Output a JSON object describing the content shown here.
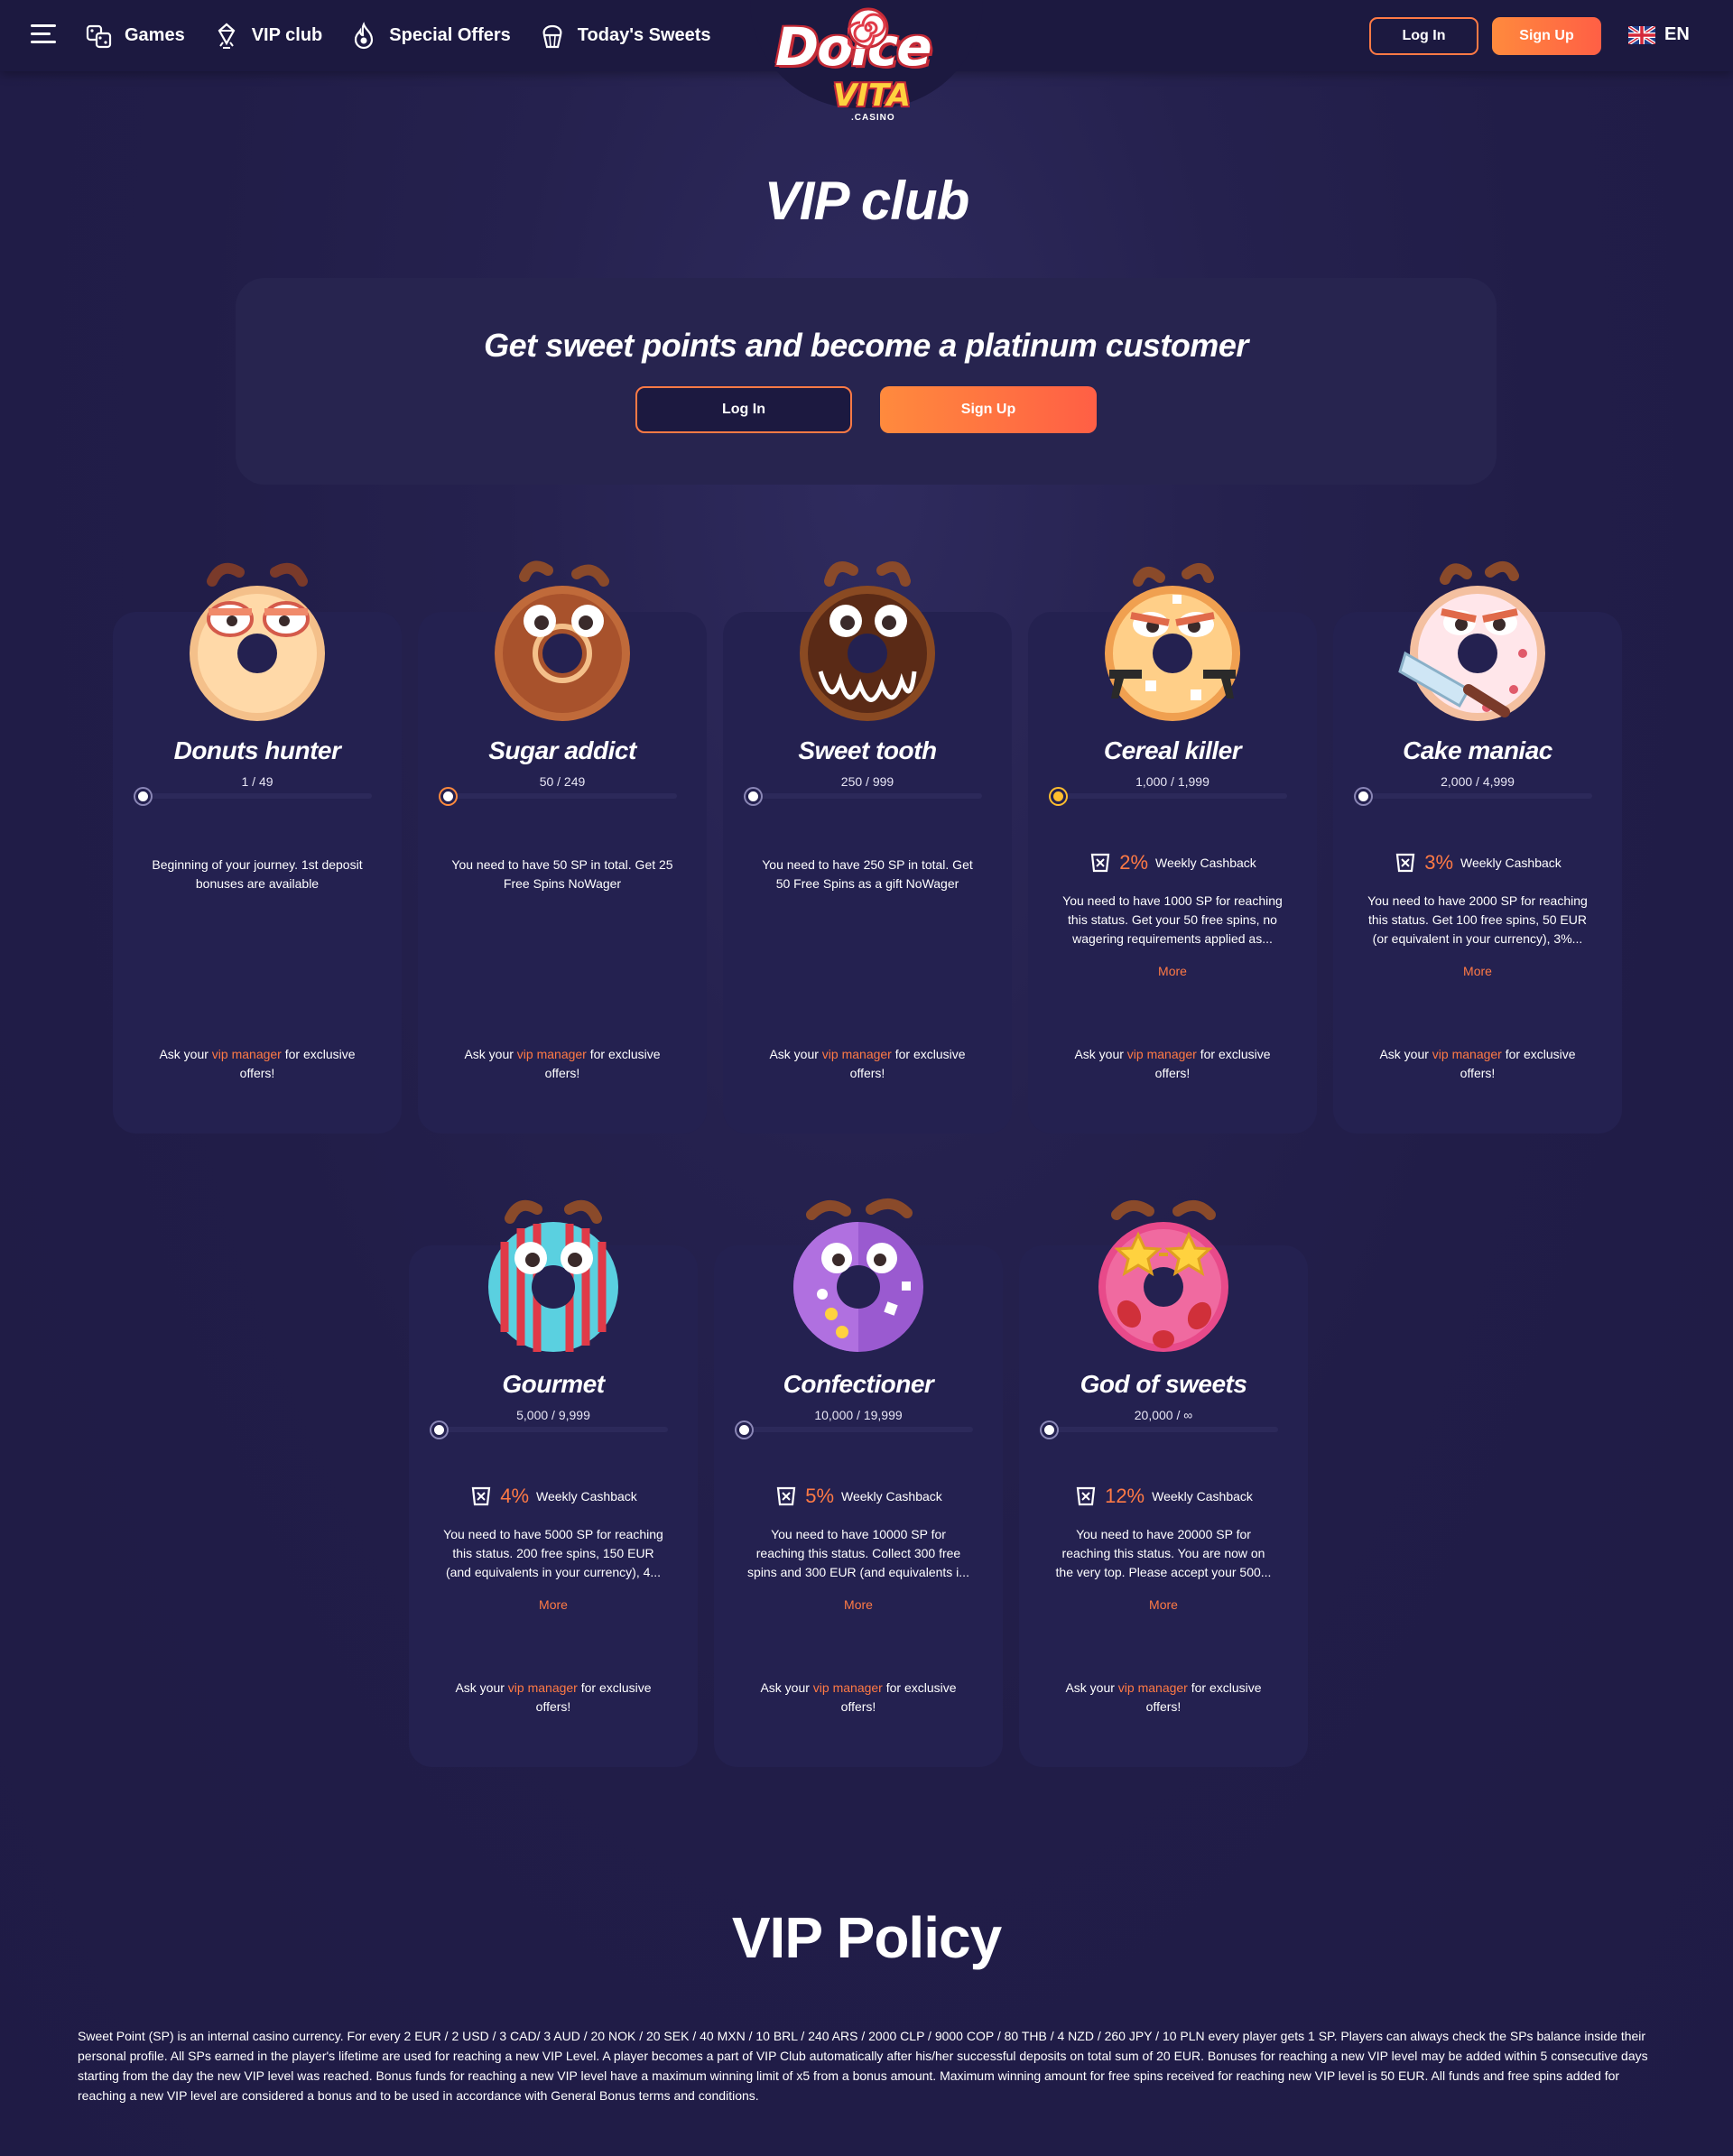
{
  "header": {
    "nav": [
      {
        "label": "Games",
        "icon": "dice-icon"
      },
      {
        "label": "VIP club",
        "icon": "diamond-crown-icon"
      },
      {
        "label": "Special Offers",
        "icon": "flame-icon"
      },
      {
        "label": "Today's Sweets",
        "icon": "cupcake-icon"
      }
    ],
    "logo": {
      "word_top": "Dolce",
      "word_bottom": "VITA",
      "sub": ".CASINO"
    },
    "login_label": "Log In",
    "signup_label": "Sign Up",
    "language": "EN"
  },
  "page_title": "VIP club",
  "promo": {
    "heading": "Get sweet points and become a platinum customer",
    "login_label": "Log In",
    "signup_label": "Sign Up"
  },
  "colors": {
    "accent": "#ff7a45",
    "background": "#211d48",
    "card": "#242150"
  },
  "levels": [
    {
      "title": "Donuts hunter",
      "range": "1 / 49",
      "desc": "Beginning of your journey. 1st deposit bonuses are available"
    },
    {
      "title": "Sugar addict",
      "range": "50 / 249",
      "desc": "You need to have 50 SP in total. Get 25 Free Spins NoWager"
    },
    {
      "title": "Sweet tooth",
      "range": "250 / 999",
      "desc": "You need to have 250 SP in total. Get 50 Free Spins as a gift NoWager"
    },
    {
      "title": "Cereal killer",
      "range": "1,000 / 1,999",
      "cashback": "2%",
      "cashback_label": "Weekly Cashback",
      "desc": "You need to have 1000 SP for reaching this status. Get your 50 free spins, no wagering requirements applied as...",
      "more": "More"
    },
    {
      "title": "Cake maniac",
      "range": "2,000 / 4,999",
      "cashback": "3%",
      "cashback_label": "Weekly Cashback",
      "desc": "You need to have 2000 SP for reaching this status. Get 100 free spins, 50 EUR (or equivalent in your currency), 3%...",
      "more": "More"
    },
    {
      "title": "Gourmet",
      "range": "5,000 / 9,999",
      "cashback": "4%",
      "cashback_label": "Weekly Cashback",
      "desc": "You need to have 5000 SP for reaching this status. 200 free spins, 150 EUR (and equivalents in your currency), 4...",
      "more": "More"
    },
    {
      "title": "Confectioner",
      "range": "10,000 / 19,999",
      "cashback": "5%",
      "cashback_label": "Weekly Cashback",
      "desc": "You need to have 10000 SP for reaching this status. Collect 300 free spins and 300 EUR (and equivalents i...",
      "more": "More"
    },
    {
      "title": "God of sweets",
      "range": "20,000 / ∞",
      "cashback": "12%",
      "cashback_label": "Weekly Cashback",
      "desc": "You need to have 20000 SP for reaching this status. You are now on the very top. Please accept your 500...",
      "more": "More"
    }
  ],
  "ask": {
    "before": "Ask your",
    "link": "vip manager",
    "after": "for exclusive offers!"
  },
  "policy": {
    "title": "VIP Policy",
    "text": "Sweet Point (SP) is an internal casino currency. For every 2 EUR / 2 USD / 3 CAD/ 3 AUD / 20 NOK / 20 SEK / 40 MXN / 10 BRL / 240 ARS / 2000 CLP / 9000 COP / 80 THB / 4 NZD / 260 JPY / 10 PLN every player gets 1 SP. Players can always check the SPs balance inside their personal profile. All SPs earned in the player's lifetime are used for reaching a new VIP Level. A player becomes a part of VIP Club automatically after his/her successful deposits on total sum of 20 EUR. Bonuses for reaching a new VIP level may be added within 5 consecutive days starting from the day the new VIP level was reached. Bonus funds for reaching a new VIP level have a maximum winning limit of x5 from a bonus amount. Maximum winning amount for free spins received for reaching new VIP level is 50 EUR. All funds and free spins added for reaching a new VIP level are considered a bonus and to be used in accordance with General Bonus terms and conditions."
  }
}
